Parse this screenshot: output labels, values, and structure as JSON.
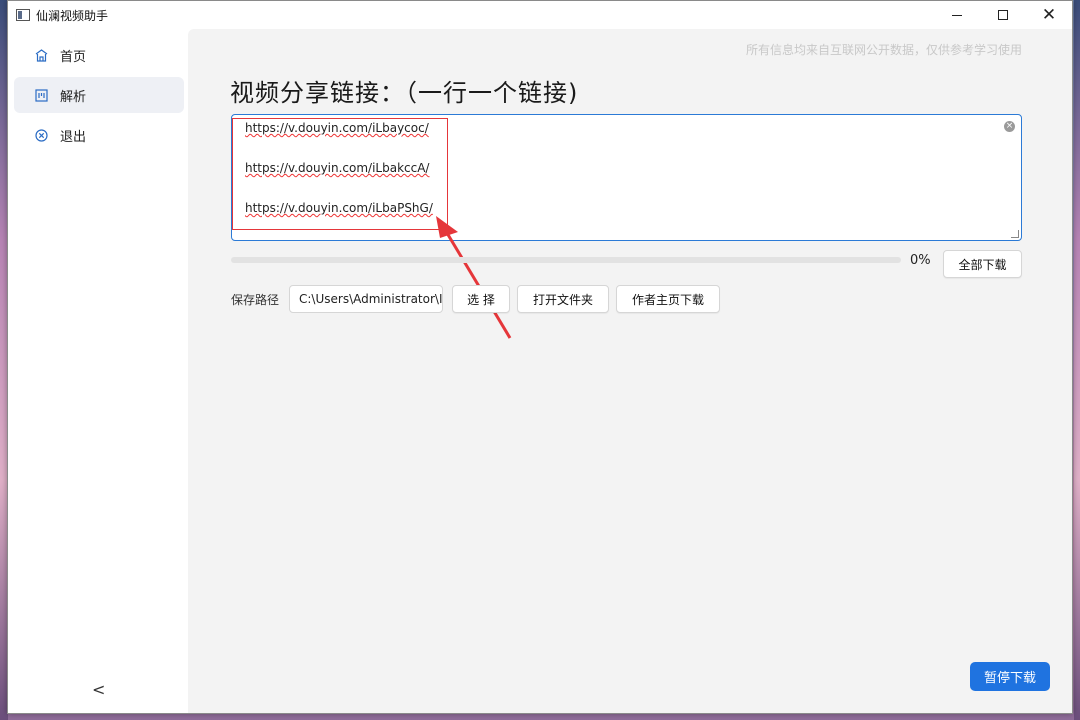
{
  "window": {
    "title": "仙澜视频助手"
  },
  "sidebar": {
    "items": [
      {
        "label": "首页",
        "icon": "home-icon"
      },
      {
        "label": "解析",
        "icon": "parse-icon"
      },
      {
        "label": "退出",
        "icon": "exit-icon"
      }
    ],
    "active_index": 1,
    "collapse_glyph": "<"
  },
  "main": {
    "disclaimer": "所有信息均来自互联网公开数据，仅供参考学习使用",
    "heading": "视频分享链接：（一行一个链接)",
    "links": [
      "https://v.douyin.com/iLbaycoc/",
      "https://v.douyin.com/iLbakccA/",
      "https://v.douyin.com/iLbaPShG/"
    ],
    "progress": {
      "percent": 0,
      "label": "0%"
    },
    "download_all_label": "全部下载",
    "save_path_label": "保存路径",
    "save_path_value": "C:\\Users\\Administrator\\I",
    "choose_label": "选 择",
    "open_folder_label": "打开文件夹",
    "author_download_label": "作者主页下载",
    "pause_label": "暂停下载"
  },
  "colors": {
    "accent": "#1f73e0",
    "annotation": "#e5363a"
  }
}
